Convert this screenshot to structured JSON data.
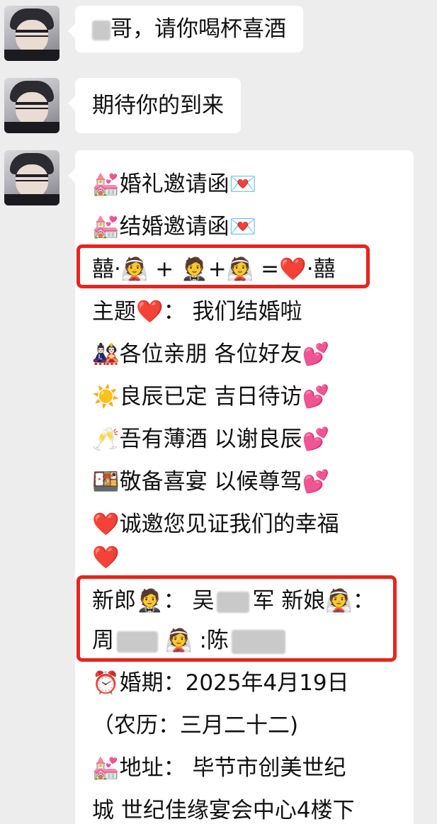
{
  "messages": [
    {
      "text_suffix": "哥，请你喝杯喜酒"
    },
    {
      "text": "期待你的到来"
    }
  ],
  "invitation": {
    "line1": "💒婚礼邀请函💌",
    "line2": "💒结婚邀请函💌",
    "line3": "囍·👰 + 🤵+👰 =❤️·囍",
    "line4": "主题❤️：  我们结婚啦",
    "line5": "🎎各位亲朋 各位好友💕",
    "line6": "☀️良辰已定 吉日待访💕",
    "line7": "🥂吾有薄酒 以谢良辰💕",
    "line8": "🍱敬备喜宴 以候尊驾💕",
    "line9": "❤️诚邀您见证我们的幸福",
    "line10": "❤️",
    "groom_label": "新郎🤵：  吴",
    "groom_suffix": "军  新娘👰：",
    "line12_a": "周",
    "line12_b": "👰 :陈",
    "line13": "⏰婚期：2025年4月19日",
    "line14": "（农历：三月二十二)",
    "line15": "💒地址：  毕节市创美世纪",
    "line16": "城  世纪佳缘宴会中心4楼下"
  },
  "colors": {
    "highlight": "#e8241c",
    "bubble": "#ffffff",
    "background": "#ededed"
  }
}
